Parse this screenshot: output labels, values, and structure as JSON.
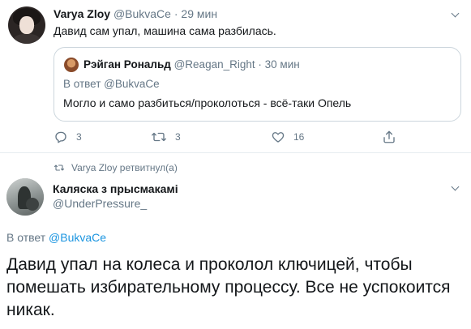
{
  "tweet1": {
    "author_name": "Varya Zloy",
    "author_handle": "@BukvaCe",
    "time_sep": "·",
    "time": "29 мин",
    "text": "Давид сам упал, машина сама разбилась.",
    "quote": {
      "author_name": "Рэйган Рональд",
      "author_handle": "@Reagan_Right",
      "time_sep": "·",
      "time": "30 мин",
      "reply_to": "В ответ @BukvaCe",
      "text": "Могло и само разбиться/проколоться - всё-таки Опель"
    },
    "actions": {
      "reply_count": "3",
      "retweet_count": "3",
      "like_count": "16"
    }
  },
  "retweet_notice": "Varya Zloy ретвитнул(а)",
  "tweet2": {
    "author_name": "Каляска з прысмакамі",
    "author_handle": "@UnderPressure_",
    "reply_prefix": "В ответ ",
    "reply_to": "@BukvaCe",
    "text": "Давид упал на колеса и проколол ключицей, чтобы помешать избирательному процессу. Все не успокоится никак."
  },
  "colors": {
    "text": "#14171a",
    "muted": "#657786",
    "link": "#1b95e0",
    "border": "#ccd6dd"
  },
  "icons": [
    "reply-icon",
    "retweet-icon",
    "like-icon",
    "share-icon",
    "caret-down-icon"
  ]
}
